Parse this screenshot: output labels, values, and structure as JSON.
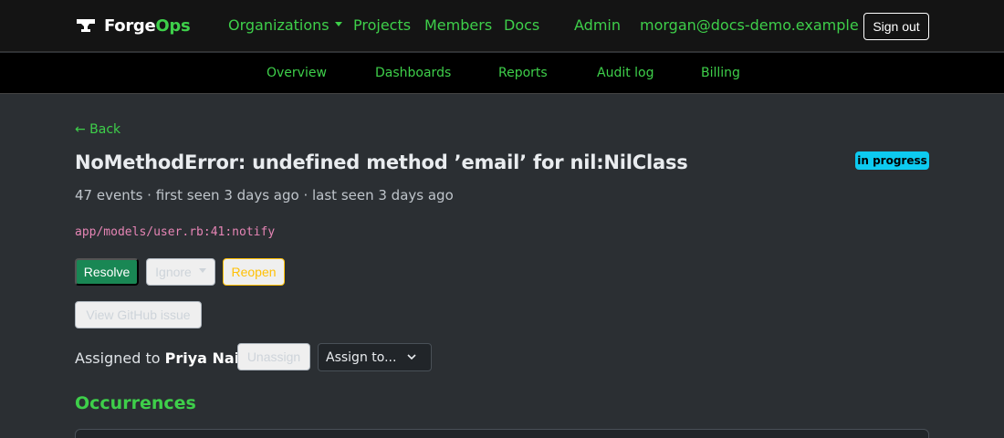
{
  "brand": {
    "name_prefix": "Forge",
    "name_accent": "Ops",
    "logo_icon": "anvil-icon"
  },
  "nav": {
    "organizations": "Organizations",
    "projects": "Projects",
    "members": "Members",
    "docs": "Docs",
    "admin": "Admin",
    "user_email": "morgan@docs-demo.example",
    "sign_out": "Sign out"
  },
  "subnav": [
    "Overview",
    "Dashboards",
    "Reports",
    "Audit log",
    "Billing"
  ],
  "page": {
    "back": "← Back",
    "title": "NoMethodError: undefined method ’email’ for nil:NilClass",
    "status_badge": "in progress",
    "meta": "47 events · first seen 3 days ago · last seen 3 days ago",
    "location": "app/models/user.rb:41:notify"
  },
  "actions": {
    "resolve": "Resolve",
    "ignore": "Ignore",
    "reopen": "Reopen",
    "github": "View GitHub issue"
  },
  "assignment": {
    "prefix": "Assigned to",
    "assignee": "Priya Nair",
    "unassign": "Unassign",
    "assign_to": "Assign to..."
  },
  "occurrences": {
    "heading": "Occurrences"
  },
  "colors": {
    "accent": "#3ecf4a",
    "resolve": "#198754",
    "reopen": "#ffc107",
    "badge": "#0dcaf0",
    "code": "#e685b5"
  }
}
